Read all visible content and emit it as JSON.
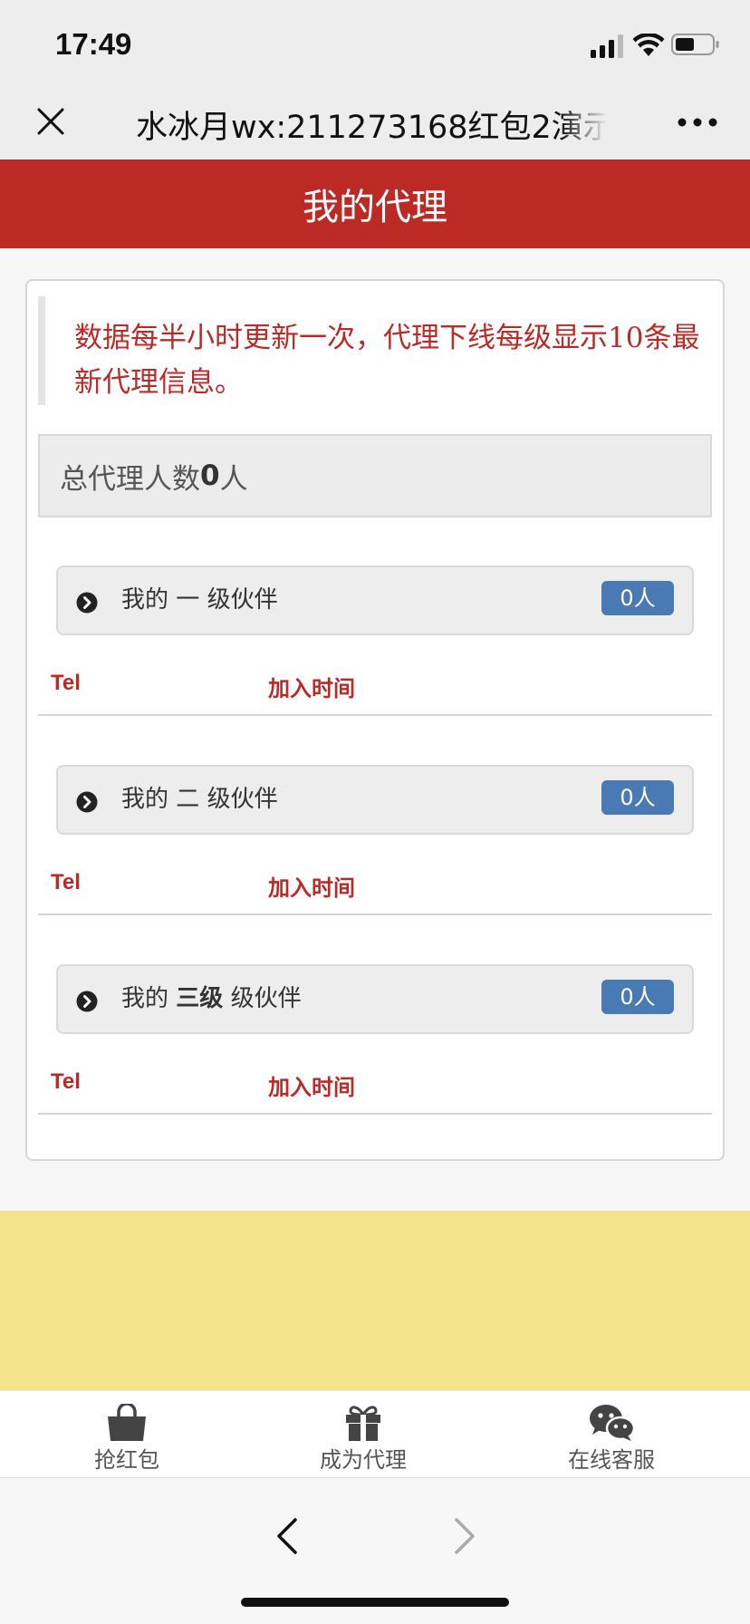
{
  "status_bar": {
    "time": "17:49"
  },
  "nav_bar": {
    "title": "水冰月wx:211273168红包2演示"
  },
  "header": {
    "title": "我的代理"
  },
  "notice": {
    "text": "数据每半小时更新一次，代理下线每级显示10条最新代理信息。"
  },
  "total": {
    "label": "总代理人数",
    "count": "0",
    "unit": "人"
  },
  "levels": [
    {
      "prefix": "我的",
      "level": "一",
      "suffix": "级伙伴",
      "count": "0人",
      "tel_label": "Tel",
      "time_label": "加入时间"
    },
    {
      "prefix": "我的",
      "level": "二",
      "suffix": "级伙伴",
      "count": "0人",
      "tel_label": "Tel",
      "time_label": "加入时间"
    },
    {
      "prefix": "我的",
      "level": "三级",
      "suffix": "级伙伴",
      "count": "0人",
      "tel_label": "Tel",
      "time_label": "加入时间"
    }
  ],
  "tabs": [
    {
      "label": "抢红包",
      "icon": "shopping-bag-icon"
    },
    {
      "label": "成为代理",
      "icon": "gift-icon"
    },
    {
      "label": "在线客服",
      "icon": "wechat-icon"
    }
  ],
  "colors": {
    "header_red": "#bb2a25",
    "badge_blue": "#4a7ab3",
    "ad_yellow": "#f3e38a"
  }
}
